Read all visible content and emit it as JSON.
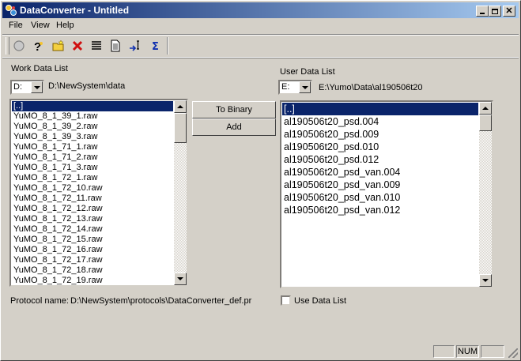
{
  "window": {
    "title": "DataConverter - Untitled"
  },
  "menu": [
    {
      "label": "File"
    },
    {
      "label": "View"
    },
    {
      "label": "Help"
    }
  ],
  "work": {
    "label": "Work Data List",
    "drive": "D:",
    "path": "D:\\NewSystem\\data",
    "items": [
      "[..]",
      "YuMO_8_1_39_1.raw",
      "YuMO_8_1_39_2.raw",
      "YuMO_8_1_39_3.raw",
      "YuMO_8_1_71_1.raw",
      "YuMO_8_1_71_2.raw",
      "YuMO_8_1_71_3.raw",
      "YuMO_8_1_72_1.raw",
      "YuMO_8_1_72_10.raw",
      "YuMO_8_1_72_11.raw",
      "YuMO_8_1_72_12.raw",
      "YuMO_8_1_72_13.raw",
      "YuMO_8_1_72_14.raw",
      "YuMO_8_1_72_15.raw",
      "YuMO_8_1_72_16.raw",
      "YuMO_8_1_72_17.raw",
      "YuMO_8_1_72_18.raw",
      "YuMO_8_1_72_19.raw"
    ],
    "selected": 0
  },
  "buttons": {
    "to_binary": "To Binary",
    "add": "Add"
  },
  "user": {
    "label": "User Data List",
    "drive": "E:",
    "path": "E:\\Yumo\\Data\\al190506t20",
    "items": [
      "[..]",
      "al190506t20_psd.004",
      "al190506t20_psd.009",
      "al190506t20_psd.010",
      "al190506t20_psd.012",
      "al190506t20_psd_van.004",
      "al190506t20_psd_van.009",
      "al190506t20_psd_van.010",
      "al190506t20_psd_van.012"
    ],
    "selected": 0
  },
  "protocol": {
    "label": "Protocol name:",
    "value": "D:\\NewSystem\\protocols\\DataConverter_def.pr"
  },
  "use_data_list": {
    "label": "Use Data List",
    "checked": false
  },
  "status": {
    "num": "NUM"
  },
  "colors": {
    "title_start": "#0a246a",
    "title_end": "#a6caf0",
    "face": "#d4d0c8",
    "selection": "#0a246a"
  }
}
